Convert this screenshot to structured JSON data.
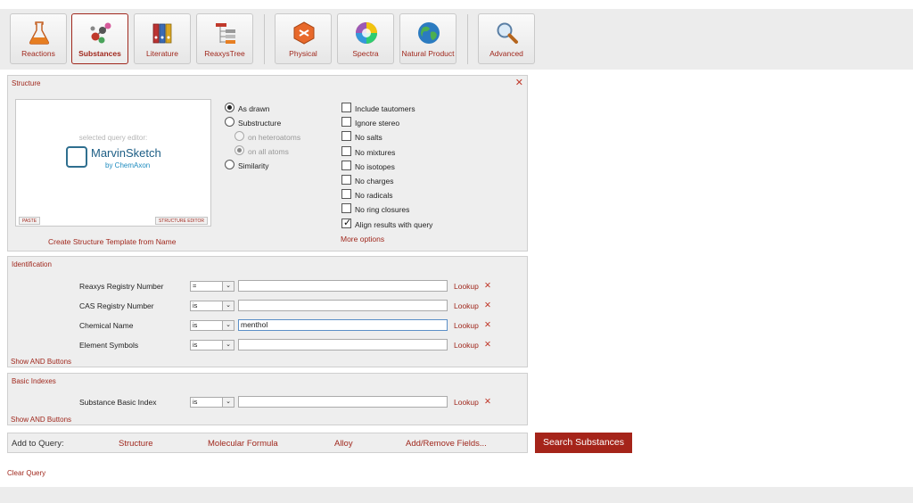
{
  "toolbar": {
    "buttons": [
      {
        "label": "Reactions",
        "icon": "flask-icon"
      },
      {
        "label": "Substances",
        "icon": "molecule-icon",
        "active": true
      },
      {
        "label": "Literature",
        "icon": "binders-icon"
      },
      {
        "label": "ReaxysTree",
        "icon": "tree-icon"
      },
      {
        "label": "Physical",
        "icon": "physical-icon"
      },
      {
        "label": "Spectra",
        "icon": "spectrum-wheel-icon"
      },
      {
        "label": "Natural Product",
        "icon": "globe-icon"
      },
      {
        "label": "Advanced",
        "icon": "magnifier-icon"
      }
    ]
  },
  "structure": {
    "title": "Structure",
    "editor": {
      "selected_label": "selected query editor:",
      "name": "MarvinSketch",
      "by": "by ChemAxon",
      "paste_label": "PASTE",
      "structure_editor_label": "STRUCTURE EDITOR"
    },
    "template_link": "Create Structure Template from Name",
    "radios": {
      "as_drawn": "As drawn",
      "substructure": "Substructure",
      "on_heteroatoms": "on heteroatoms",
      "on_all_atoms": "on all atoms",
      "similarity": "Similarity"
    },
    "checks": [
      {
        "label": "Include tautomers",
        "checked": false
      },
      {
        "label": "Ignore stereo",
        "checked": false
      },
      {
        "label": "No salts",
        "checked": false
      },
      {
        "label": "No mixtures",
        "checked": false
      },
      {
        "label": "No isotopes",
        "checked": false
      },
      {
        "label": "No charges",
        "checked": false
      },
      {
        "label": "No radicals",
        "checked": false
      },
      {
        "label": "No ring closures",
        "checked": false
      },
      {
        "label": "Align results with query",
        "checked": true
      }
    ],
    "more_options": "More options"
  },
  "identification": {
    "title": "Identification",
    "rows": [
      {
        "label": "Reaxys Registry Number",
        "op": "=",
        "value": ""
      },
      {
        "label": "CAS Registry Number",
        "op": "is",
        "value": ""
      },
      {
        "label": "Chemical Name",
        "op": "is",
        "value": "menthol"
      },
      {
        "label": "Element Symbols",
        "op": "is",
        "value": ""
      }
    ],
    "lookup": "Lookup",
    "show_and": "Show AND Buttons"
  },
  "basic_indexes": {
    "title": "Basic Indexes",
    "rows": [
      {
        "label": "Substance Basic Index",
        "op": "is",
        "value": ""
      }
    ],
    "lookup": "Lookup",
    "show_and": "Show AND Buttons"
  },
  "add_to_query": {
    "label": "Add to Query:",
    "structure": "Structure",
    "molecular_formula": "Molecular Formula",
    "alloy": "Alloy",
    "add_remove": "Add/Remove Fields..."
  },
  "search_button": "Search Substances",
  "clear_query": "Clear Query"
}
